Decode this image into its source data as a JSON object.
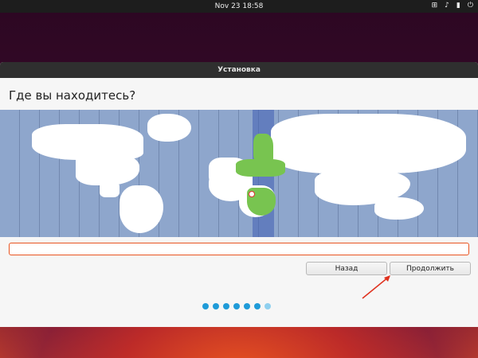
{
  "topbar": {
    "clock": "Nov 23  18:58",
    "icons": [
      "network-icon",
      "volume-icon",
      "battery-icon",
      "power-icon"
    ]
  },
  "window": {
    "title": "Установка",
    "heading": "Где вы находитесь?",
    "timezone_value": "",
    "buttons": {
      "back": "Назад",
      "continue": "Продолжить"
    },
    "progress": {
      "total_steps": 7,
      "completed_steps": 6
    }
  },
  "colors": {
    "accent": "#e95420",
    "selected_region": "#78c450",
    "map_sea": "#8ea6cc",
    "progress_dot": "#1f9bd8"
  }
}
